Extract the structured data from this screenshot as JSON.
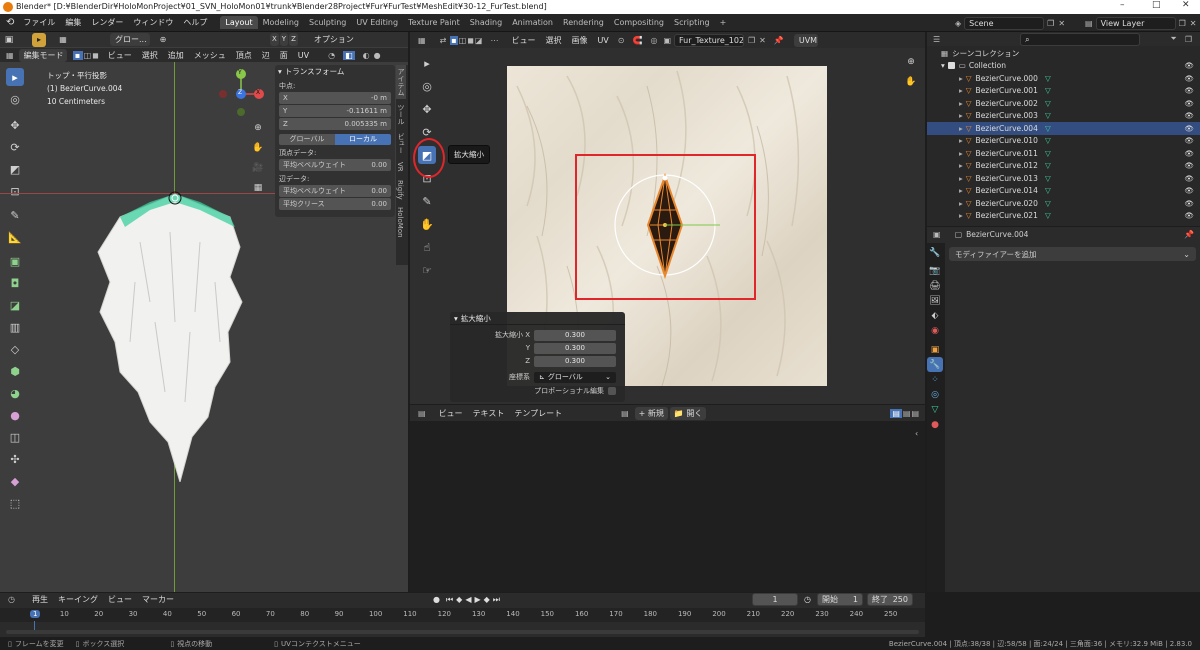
{
  "window": {
    "title": "Blender* [D:¥BlenderDir¥HoloMonProject¥01_SVN_HoloMon01¥trunk¥Blender28Project¥Fur¥FurTest¥MeshEdit¥30-12_FurTest.blend]",
    "minimize": "–",
    "maximize": "□",
    "close": "✕"
  },
  "topbar": {
    "menus": [
      "ファイル",
      "編集",
      "レンダー",
      "ウィンドウ",
      "ヘルプ"
    ],
    "workspaces": [
      "Layout",
      "Modeling",
      "Sculpting",
      "UV Editing",
      "Texture Paint",
      "Shading",
      "Animation",
      "Rendering",
      "Compositing",
      "Scripting"
    ],
    "active_workspace": "Layout",
    "add_workspace": "+",
    "scene": "Scene",
    "view_layer": "View Layer"
  },
  "viewport": {
    "mode": "編集モード",
    "menus": [
      "ビュー",
      "選択",
      "追加",
      "メッシュ",
      "頂点",
      "辺",
      "面",
      "UV"
    ],
    "select_mode": "グロー...",
    "xyz": [
      "X",
      "Y",
      "Z"
    ],
    "options": "オプション",
    "info": [
      "トップ・平行投影",
      "(1) BezierCurve.004",
      "10 Centimeters"
    ],
    "sidebar_tabs": [
      "アイテム",
      "ツール",
      "ビュー",
      "VR",
      "Rigify",
      "HoloMon"
    ],
    "gizmo": {
      "x": "X",
      "y": "Y",
      "z": "Z"
    }
  },
  "transform_panel": {
    "title": "トランスフォーム",
    "median_label": "中点:",
    "fields": [
      {
        "axis": "X",
        "value": "-0 m"
      },
      {
        "axis": "Y",
        "value": "-0.11611 m"
      },
      {
        "axis": "Z",
        "value": "0.005335 m"
      }
    ],
    "global": "グローバル",
    "local": "ローカル",
    "vertex_data": "頂点データ:",
    "vertex_bevel_label": "平均ベベルウェイト",
    "vertex_bevel_value": "0.00",
    "edge_data": "辺データ:",
    "edge_bevel_label": "平均ベベルウェイト",
    "edge_bevel_value": "0.00",
    "edge_crease_label": "平均クリース",
    "edge_crease_value": "0.00"
  },
  "uv_editor": {
    "menus": [
      "ビュー",
      "選択",
      "画像",
      "UV"
    ],
    "image_name": "Fur_Texture_1024.p...",
    "uvmap": "UVMap",
    "tooltip": "拡大縮小",
    "tools": [
      "select-icon",
      "cursor-icon",
      "move-icon",
      "rotate-icon",
      "scale-icon",
      "transform-icon",
      "annotate-icon",
      "grab-icon",
      "relax-icon",
      "pinch-icon"
    ]
  },
  "redo_panel": {
    "title": "拡大縮小",
    "scale_label": "拡大縮小 X",
    "scale_x": "0.300",
    "y_label": "Y",
    "scale_y": "0.300",
    "z_label": "Z",
    "scale_z": "0.300",
    "orient_label": "座標系",
    "orient_value": "グローバル",
    "proportional": "プロポーショナル編集"
  },
  "text_editor": {
    "menus": [
      "ビュー",
      "テキスト",
      "テンプレート"
    ],
    "new": "新規",
    "open": "開く"
  },
  "outliner": {
    "title": "シーンコレクション",
    "collection": "Collection",
    "items": [
      {
        "name": "BezierCurve.000",
        "selected": false
      },
      {
        "name": "BezierCurve.001",
        "selected": false
      },
      {
        "name": "BezierCurve.002",
        "selected": false
      },
      {
        "name": "BezierCurve.003",
        "selected": false
      },
      {
        "name": "BezierCurve.004",
        "selected": true
      },
      {
        "name": "BezierCurve.010",
        "selected": false
      },
      {
        "name": "BezierCurve.011",
        "selected": false
      },
      {
        "name": "BezierCurve.012",
        "selected": false
      },
      {
        "name": "BezierCurve.013",
        "selected": false
      },
      {
        "name": "BezierCurve.014",
        "selected": false
      },
      {
        "name": "BezierCurve.020",
        "selected": false
      },
      {
        "name": "BezierCurve.021",
        "selected": false
      }
    ]
  },
  "properties": {
    "object": "BezierCurve.004",
    "add_modifier": "モディファイアーを追加"
  },
  "timeline": {
    "menus": [
      "再生",
      "キーイング",
      "ビュー",
      "マーカー"
    ],
    "current_frame": "1",
    "start_label": "開始",
    "start": "1",
    "end_label": "終了",
    "end": "250",
    "ticks": [
      "1",
      "10",
      "20",
      "30",
      "40",
      "50",
      "60",
      "70",
      "80",
      "90",
      "100",
      "110",
      "120",
      "130",
      "140",
      "150",
      "160",
      "170",
      "180",
      "190",
      "200",
      "210",
      "220",
      "230",
      "240",
      "250"
    ]
  },
  "statusbar": {
    "left": [
      "フレームを変更",
      "ボックス選択",
      "視点の移動",
      "UVコンテクストメニュー"
    ],
    "right": "BezierCurve.004 | 頂点:38/38 | 辺:58/58 | 面:24/24 | 三角面:36 | メモリ:32.9 MiB | 2.83.0"
  },
  "colors": {
    "accent": "#4772b3",
    "highlight_red": "#e0262a",
    "object_orange": "#e9872c",
    "mesh_green": "#3ecfa0"
  }
}
